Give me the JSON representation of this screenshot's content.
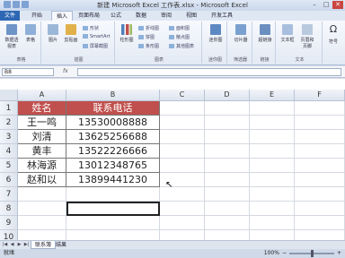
{
  "window": {
    "title": "新建 Microsoft Excel 工作表.xlsx - Microsoft Excel",
    "min": "–",
    "max": "□",
    "close": "✕"
  },
  "ribbon_tabs": [
    "文件",
    "开始",
    "插入",
    "页面布局",
    "公式",
    "数据",
    "审阅",
    "视图",
    "开发工具"
  ],
  "ribbon_groups": {
    "tables": {
      "label": "表格",
      "pivot": "数据透视表",
      "table": "表格"
    },
    "illustrations": {
      "label": "插图",
      "picture": "图片",
      "clipart": "剪贴画",
      "shapes": "形状",
      "smartart": "SmartArt",
      "screenshot": "屏幕截图"
    },
    "charts": {
      "label": "图表",
      "column": "柱形图",
      "line": "折线图",
      "pie": "饼图",
      "bar": "条形图",
      "area": "面积图",
      "scatter": "散点图",
      "other": "其他图表"
    },
    "sparklines": {
      "label": "迷你图",
      "btn": "迷你图"
    },
    "filter": {
      "label": "筛选器",
      "slicer": "切片器"
    },
    "links": {
      "label": "链接",
      "hyperlink": "超链接"
    },
    "text": {
      "label": "文本",
      "textbox": "文本框",
      "header": "页眉和页脚"
    },
    "symbols": {
      "label": "符号",
      "symbol": "符号"
    }
  },
  "formula_bar": {
    "name_box": "B8",
    "fx": "fx",
    "value": ""
  },
  "columns": [
    "A",
    "B",
    "C",
    "D",
    "E",
    "F"
  ],
  "rows": [
    "1",
    "2",
    "3",
    "4",
    "5",
    "6",
    "7",
    "8",
    "9",
    "10"
  ],
  "table": {
    "headers": [
      "姓名",
      "联系电话"
    ],
    "rows": [
      [
        "王一鸣",
        "13530008888"
      ],
      [
        "刘清",
        "13625256688"
      ],
      [
        "黄丰",
        "13522226666"
      ],
      [
        "林海源",
        "13012348765"
      ],
      [
        "赵和以",
        "13899441230"
      ]
    ]
  },
  "sheet_tabs": [
    "联系簿",
    "结果"
  ],
  "status": {
    "left": "就绪",
    "zoom": "100%"
  },
  "colors": {
    "header_fill": "#c0504d",
    "file_tab": "#2d67b3"
  }
}
